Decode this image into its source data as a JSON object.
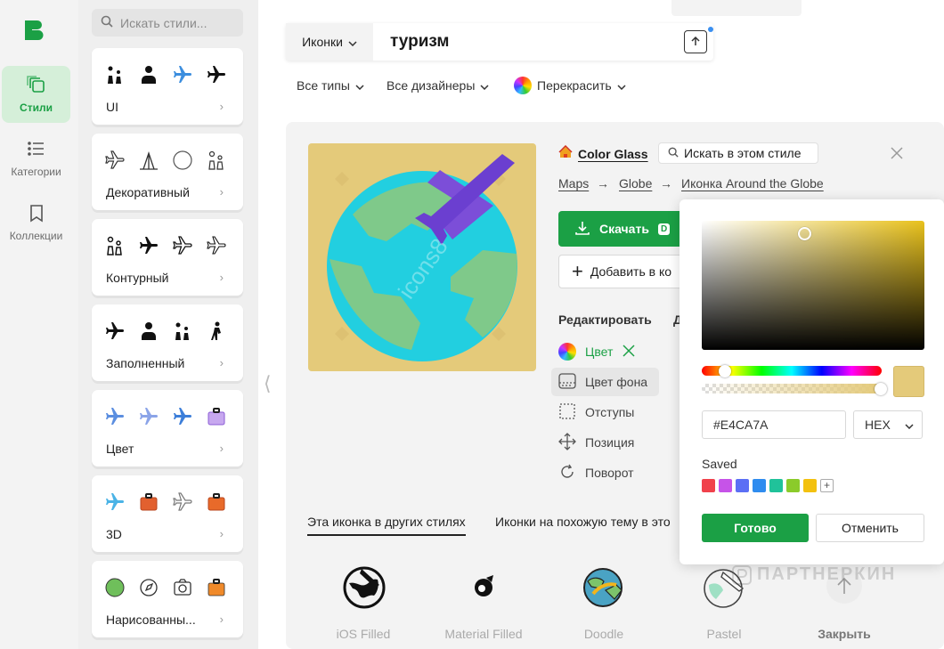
{
  "sidebar": {
    "items": [
      {
        "label": "Стили",
        "icon": "stack-icon",
        "active": true
      },
      {
        "label": "Категории",
        "icon": "list-icon",
        "active": false
      },
      {
        "label": "Коллекции",
        "icon": "bookmark-icon",
        "active": false
      }
    ]
  },
  "styles_panel": {
    "search_placeholder": "Искать стили...",
    "cards": [
      {
        "label": "UI",
        "icons": [
          "family-icon",
          "doctor-icon",
          "airplane-icon",
          "airplane-icon"
        ]
      },
      {
        "label": "Декоративный",
        "icons": [
          "airplane-icon",
          "tent-icon",
          "globe-icon",
          "family-icon"
        ]
      },
      {
        "label": "Контурный",
        "icons": [
          "family-icon",
          "airplane-icon",
          "airplane-icon",
          "airplane-icon"
        ]
      },
      {
        "label": "Заполненный",
        "icons": [
          "airplane-icon",
          "doctor-icon",
          "family-icon",
          "hiker-icon"
        ]
      },
      {
        "label": "Цвет",
        "icons": [
          "airplane-icon",
          "airplane-icon",
          "airplane-icon",
          "suitcase-icon"
        ]
      },
      {
        "label": "3D",
        "icons": [
          "airplane-icon",
          "suitcase-icon",
          "airplane-icon",
          "suitcase-icon"
        ]
      },
      {
        "label": "Нарисованны...",
        "icons": [
          "globe-icon",
          "compass-icon",
          "camera-icon",
          "suitcase-icon"
        ]
      }
    ]
  },
  "search": {
    "type_label": "Иконки",
    "query": "туризм"
  },
  "filters": {
    "types": "Все типы",
    "designers": "Все дизайнеры",
    "recolor": "Перекрасить"
  },
  "detail": {
    "style_name": "Color Glass",
    "search_in_style": "Искать в этом стиле",
    "breadcrumbs": [
      "Maps",
      "Globe",
      "Иконка Around the Globe"
    ],
    "breadcrumb_separator": "→",
    "download_label": "Скачать",
    "download_badge": "D",
    "add_label": "Добавить в ко",
    "edit_heading": "Редактировать",
    "second_heading": "Д",
    "edit_items": [
      {
        "label": "Цвет",
        "icon": "color-wheel-icon"
      },
      {
        "label": "Цвет фона",
        "icon": "background-icon"
      },
      {
        "label": "Отступы",
        "icon": "padding-icon"
      },
      {
        "label": "Позиция",
        "icon": "move-icon"
      },
      {
        "label": "Поворот",
        "icon": "rotate-icon"
      }
    ],
    "preview_watermark": "icons8",
    "preview_bg": "#e4ca7a"
  },
  "tabs": [
    "Эта иконка в других стилях",
    "Иконки на похожую тему в это"
  ],
  "other_styles": [
    {
      "label": "iOS Filled"
    },
    {
      "label": "Material Filled"
    },
    {
      "label": "Doodle"
    },
    {
      "label": "Pastel"
    }
  ],
  "close_label": "Закрыть",
  "color_picker": {
    "hue_color": "#e9c21c",
    "current_color": "#e4ca7a",
    "hex_value": "#E4CA7A",
    "format": "HEX",
    "saved_label": "Saved",
    "saved_colors": [
      "#f0414b",
      "#c653e8",
      "#5b6ff5",
      "#2f8cef",
      "#20c29a",
      "#8bcb2a",
      "#f3c10f"
    ],
    "ok_label": "Готово",
    "cancel_label": "Отменить"
  },
  "watermark": "ПАРТНЕРКИН",
  "colors": {
    "accent": "#1ba045",
    "panel_bg": "#f3f3f3"
  }
}
